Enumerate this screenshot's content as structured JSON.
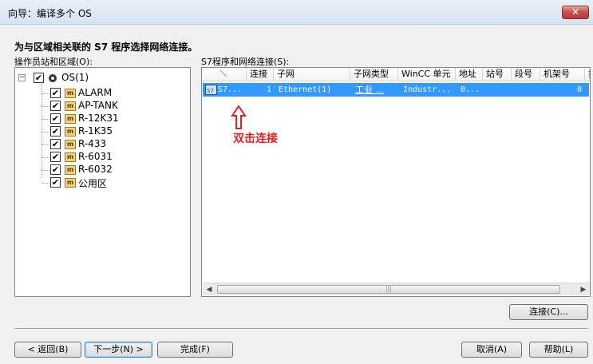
{
  "window": {
    "title": "向导：编译多个 OS",
    "close_label": "✕"
  },
  "heading": "为与区域相关联的 S7 程序选择网络连接。",
  "left_panel": {
    "label": "操作员站和区域(O):",
    "root": {
      "label": "OS(1)",
      "checked": true
    },
    "items": [
      {
        "label": "ALARM"
      },
      {
        "label": "AP-TANK"
      },
      {
        "label": "R-12K31"
      },
      {
        "label": "R-1K35"
      },
      {
        "label": "R-433"
      },
      {
        "label": "R-6031"
      },
      {
        "label": "R-6032"
      },
      {
        "label": "公用区"
      }
    ]
  },
  "right_panel": {
    "label": "S7程序和网络连接(S):",
    "columns": [
      "",
      "连接",
      "子网",
      "子网类型",
      "WinCC 单元",
      "地址",
      "站号",
      "段号",
      "机架号",
      "插"
    ],
    "rows": [
      {
        "s7": "S7...",
        "conn": "1",
        "subnet": "Ethernet(1)",
        "type": "工业 ...",
        "wincc": "Industr...",
        "addr": "0...",
        "rack": "0"
      }
    ]
  },
  "annotation": {
    "text": "双击连接",
    "color": "#e02020"
  },
  "buttons": {
    "connect": "连接(C)...",
    "back": "< 返回(B)",
    "next": "下一步(N) >",
    "finish": "完成(F)",
    "cancel": "取消(A)",
    "help": "帮助(L)"
  }
}
